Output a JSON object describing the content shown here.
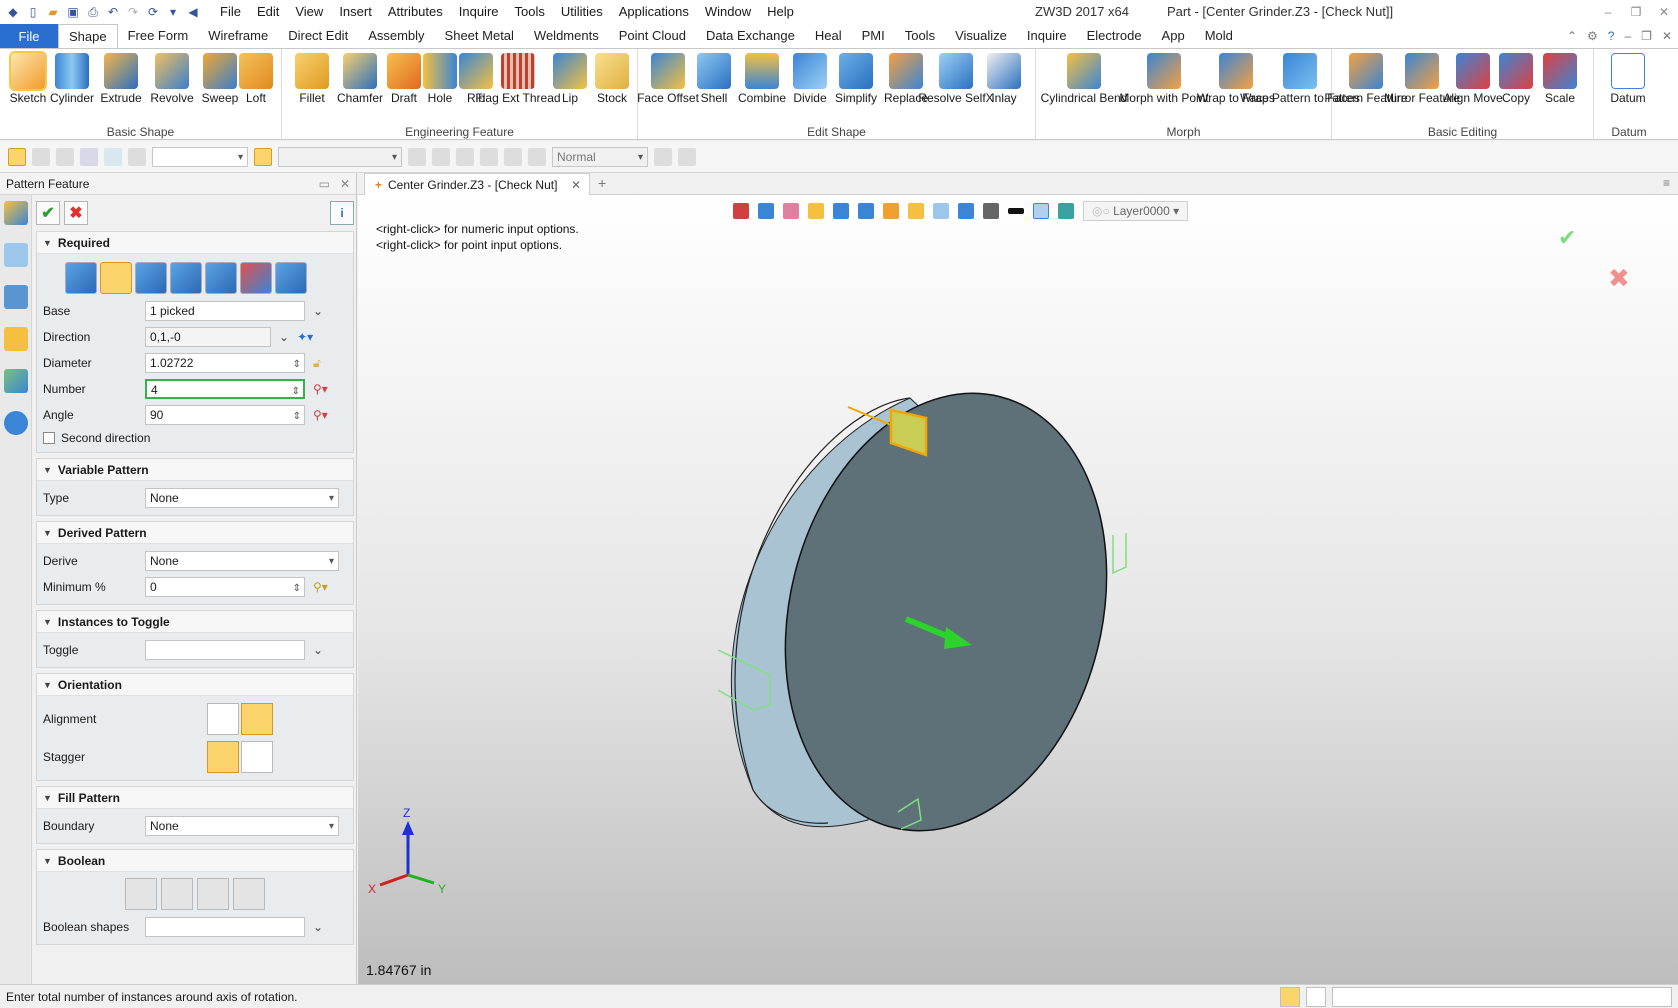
{
  "title_bar": {
    "menu": [
      "File",
      "Edit",
      "View",
      "Insert",
      "Attributes",
      "Inquire",
      "Tools",
      "Utilities",
      "Applications",
      "Window",
      "Help"
    ],
    "app_title": "ZW3D 2017  x64",
    "doc_title": "Part - [Center Grinder.Z3 - [Check Nut]]"
  },
  "ribbon_tabs": {
    "file": "File",
    "tabs": [
      "Shape",
      "Free Form",
      "Wireframe",
      "Direct Edit",
      "Assembly",
      "Sheet Metal",
      "Weldments",
      "Point Cloud",
      "Data Exchange",
      "Heal",
      "PMI",
      "Tools",
      "Visualize",
      "Inquire",
      "Electrode",
      "App",
      "Mold"
    ],
    "active": "Shape"
  },
  "ribbon": {
    "basic_shape": {
      "label": "Basic Shape",
      "buttons": [
        "Sketch",
        "Cylinder",
        "Extrude",
        "Revolve",
        "Sweep",
        "Loft"
      ]
    },
    "engineering_feature": {
      "label": "Engineering Feature",
      "buttons": [
        "Fillet",
        "Chamfer",
        "Draft",
        "Hole",
        "Rib",
        "Flag Ext Thread",
        "Lip",
        "Stock"
      ]
    },
    "edit_shape": {
      "label": "Edit Shape",
      "buttons": [
        "Face Offset",
        "Shell",
        "Combine",
        "Divide",
        "Simplify",
        "Replace",
        "Resolve SelfX",
        "Inlay"
      ]
    },
    "morph": {
      "label": "Morph",
      "buttons": [
        "Cylindrical Bend",
        "Morph with Point",
        "Wrap to Faces",
        "Wrap Pattern to Faces"
      ]
    },
    "basic_editing": {
      "label": "Basic Editing",
      "buttons": [
        "Pattern Feature",
        "Mirror Feature",
        "Align Move",
        "Copy",
        "Scale"
      ]
    },
    "datum": {
      "label": "Datum",
      "buttons": [
        "Datum"
      ]
    }
  },
  "toolbar2": {
    "filter_value": "Normal"
  },
  "panel": {
    "title": "Pattern Feature",
    "required": {
      "header": "Required",
      "base_label": "Base",
      "base_value": "1 picked",
      "direction_label": "Direction",
      "direction_value": "0,1,-0",
      "diameter_label": "Diameter",
      "diameter_value": "1.02722",
      "number_label": "Number",
      "number_value": "4",
      "angle_label": "Angle",
      "angle_value": "90",
      "second_direction": "Second direction"
    },
    "variable_pattern": {
      "header": "Variable Pattern",
      "type_label": "Type",
      "type_value": "None"
    },
    "derived_pattern": {
      "header": "Derived Pattern",
      "derive_label": "Derive",
      "derive_value": "None",
      "min_label": "Minimum %",
      "min_value": "0"
    },
    "instances": {
      "header": "Instances to Toggle",
      "toggle_label": "Toggle",
      "toggle_value": ""
    },
    "orientation": {
      "header": "Orientation",
      "alignment_label": "Alignment",
      "stagger_label": "Stagger"
    },
    "fill_pattern": {
      "header": "Fill Pattern",
      "boundary_label": "Boundary",
      "boundary_value": "None"
    },
    "boolean": {
      "header": "Boolean",
      "shapes_label": "Boolean shapes",
      "shapes_value": ""
    }
  },
  "document": {
    "tab_label": "Center Grinder.Z3 - [Check Nut]",
    "hint1": "<right-click> for numeric input options.",
    "hint2": "<right-click> for point input options.",
    "layer": "Layer0000",
    "measurement": "1.84767 in",
    "axis_x": "X",
    "axis_y": "Y",
    "axis_z": "Z"
  },
  "status": {
    "message": "Enter total number of instances around axis of rotation."
  }
}
